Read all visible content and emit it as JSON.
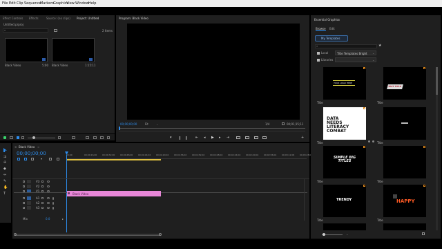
{
  "menu": [
    "File",
    "Edit",
    "Clip",
    "Sequence",
    "Markers",
    "Graphics",
    "View",
    "Window",
    "Help"
  ],
  "left_panel": {
    "tabs": [
      "Effect Controls",
      "Effects",
      "Source: (no clips)",
      "Project: Untitled"
    ],
    "project_file": "Untitled.prproj",
    "item_count": "2 Items",
    "clips": [
      {
        "name": "Black Video",
        "duration": "5:00"
      },
      {
        "name": "Black Video",
        "duration": "1:15:11"
      }
    ]
  },
  "program": {
    "title": "Program: Black Video",
    "timecode": "00;00;00;00",
    "fit": "Fit",
    "resolution": "1/4",
    "duration": "00;01;15;11"
  },
  "timeline": {
    "tab": "Black Video",
    "timecode": "00;00;00;00",
    "ruler": [
      "00;00",
      "00;00;16;00",
      "00;00;32;00",
      "00;00;48;00",
      "00;01;04;02",
      "00;01;20;02",
      "00;01;36;02",
      "00;01;52;02",
      "00;02;08;04",
      "00;02;24;04",
      "00;02;40;04",
      "00;02;56;04",
      "00;03;12;06",
      "00;03;28;06"
    ],
    "video_tracks": [
      "V3",
      "V2",
      "V1"
    ],
    "audio_tracks": [
      "A1",
      "A2",
      "A3"
    ],
    "master": "Mix",
    "master_value": "0.0",
    "clip_label": "Black Video",
    "clip_color": "#e887d8"
  },
  "graphics": {
    "title": "Essential Graphics",
    "tabs": [
      "Browse",
      "Edit"
    ],
    "my_templates": "My Templates",
    "local_label": "Local",
    "local_value": "Title Templates Bright",
    "libraries_label": "Libraries",
    "templates": [
      {
        "caption": "Title",
        "art": "YOUR LOGO HERE"
      },
      {
        "caption": "Title",
        "art": "TEXT TITLE"
      },
      {
        "caption": "Title",
        "art": "DATA NEEDS LITERACY COMBAT"
      },
      {
        "caption": "Title",
        "art": "text"
      },
      {
        "caption": "Title",
        "art": "SIMPLE BIG TITLES"
      },
      {
        "caption": "Title",
        "art": ""
      },
      {
        "caption": "Title",
        "art": "TRENDY"
      },
      {
        "caption": "Title",
        "art": "HAPPY"
      }
    ]
  },
  "colors": {
    "accent": "#2d8ceb",
    "clip": "#e887d8",
    "timecode": "#2d8ceb"
  }
}
